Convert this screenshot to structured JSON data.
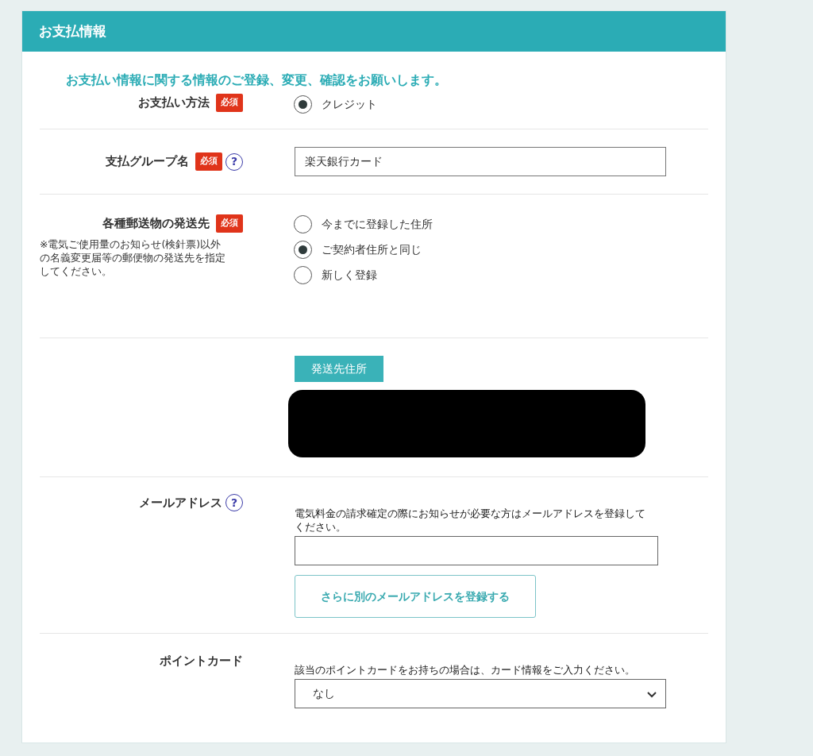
{
  "header": {
    "title": "お支払情報"
  },
  "help_icon": "?",
  "intro": "お支払い情報に関する情報のご登録、変更、確認をお願いします。",
  "rows": [
    {
      "kind": "radio",
      "label": "お支払い方法",
      "required": true,
      "badge": "必須",
      "help": false,
      "options": [
        {
          "label": "クレジット",
          "selected": true
        }
      ]
    },
    {
      "kind": "text",
      "label": "支払グループ名",
      "required": true,
      "badge": "必須",
      "help": true,
      "value": "楽天銀行カード"
    },
    {
      "kind": "radio",
      "label": "各種郵送物の発送先",
      "required": true,
      "badge": "必須",
      "help": false,
      "note": "※電気ご使用量のお知らせ(検針票)以外の名義変更届等の郵便物の発送先を指定してください。",
      "options": [
        {
          "label": "今までに登録した住所",
          "selected": false
        },
        {
          "label": "ご契約者住所と同じ",
          "selected": true
        },
        {
          "label": "新しく登録",
          "selected": false
        }
      ]
    },
    {
      "kind": "address",
      "tag": "発送先住所"
    },
    {
      "kind": "email",
      "label": "メールアドレス",
      "required": false,
      "help": true,
      "description": "電気料金の請求確定の際にお知らせが必要な方はメールアドレスを登録してください。",
      "button": "さらに別のメールアドレスを登録する"
    },
    {
      "kind": "select",
      "label": "ポイントカード",
      "required": false,
      "help": false,
      "description": "該当のポイントカードをお持ちの場合は、カード情報をご入力ください。",
      "value": "なし"
    }
  ]
}
